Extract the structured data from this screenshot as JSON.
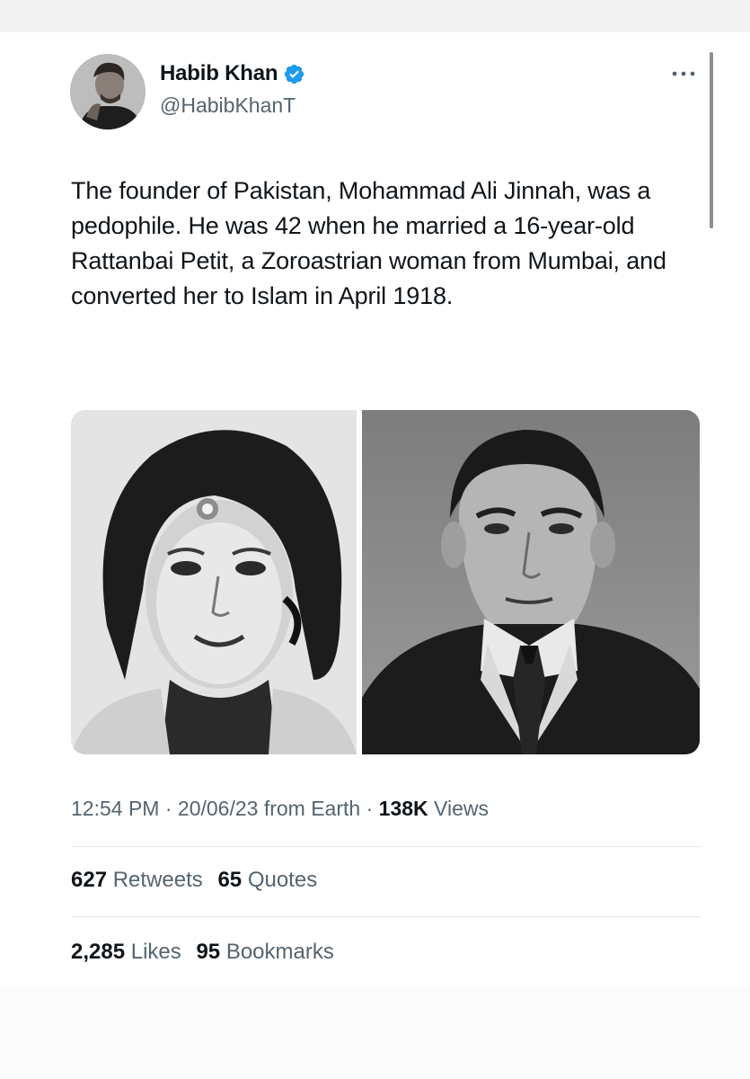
{
  "author": {
    "name": "Habib Khan",
    "handle": "@HabibKhanT",
    "verified": true,
    "avatar_icon": "profile-photo"
  },
  "menu": {
    "more_icon": "more-horizontal-icon"
  },
  "tweet": {
    "text": "The founder of Pakistan, Mohammad Ali Jinnah, was a pedophile. He was 42 when he married a 16-year-old Rattanbai Petit, a Zoroastrian woman from Mumbai, and converted her to Islam in April 1918."
  },
  "media": {
    "images": [
      {
        "icon": "portrait-woman-photo"
      },
      {
        "icon": "portrait-man-photo"
      }
    ]
  },
  "meta": {
    "time": "12:54 PM",
    "sep1": "·",
    "date": "20/06/23",
    "source": "from Earth",
    "sep2": "·",
    "views_count": "138K",
    "views_label": "Views"
  },
  "stats": {
    "retweets_count": "627",
    "retweets_label": "Retweets",
    "quotes_count": "65",
    "quotes_label": "Quotes",
    "likes_count": "2,285",
    "likes_label": "Likes",
    "bookmarks_count": "95",
    "bookmarks_label": "Bookmarks"
  },
  "colors": {
    "verified_blue": "#1d9bf0",
    "secondary_text": "#536471",
    "primary_text": "#0f1419"
  }
}
